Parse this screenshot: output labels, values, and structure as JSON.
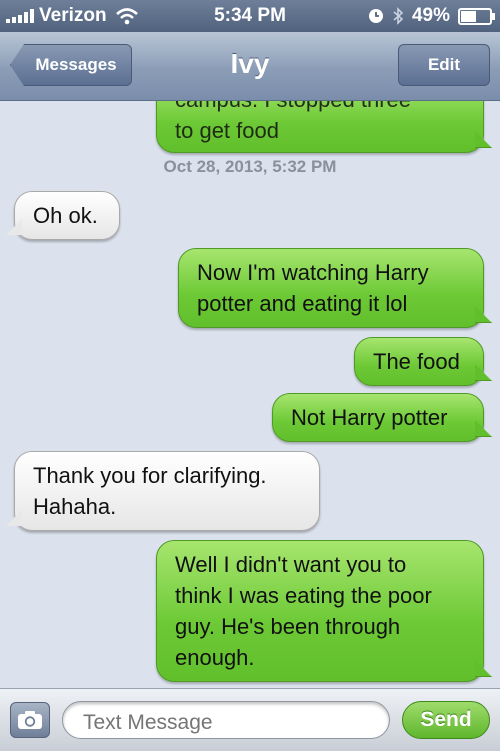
{
  "status_bar": {
    "carrier": "Verizon",
    "time": "5:34 PM",
    "battery": "49%",
    "battery_level": 0.49,
    "icons": [
      "signal-bars-icon",
      "wifi-icon",
      "alarm-clock-icon",
      "bluetooth-icon",
      "battery-icon"
    ]
  },
  "nav": {
    "back_label": "Messages",
    "title": "Ivy",
    "edit_label": "Edit"
  },
  "conversation": {
    "partial_message": {
      "from": "me",
      "line_cut": "campus. I stopped three",
      "line_visible": "to get food"
    },
    "timestamp": "Oct 28, 2013, 5:32 PM",
    "messages": [
      {
        "from": "them",
        "lines": [
          "Oh ok."
        ]
      },
      {
        "from": "me",
        "lines": [
          "Now I'm watching Harry",
          "potter and eating it lol"
        ]
      },
      {
        "from": "me",
        "lines": [
          "The food"
        ]
      },
      {
        "from": "me",
        "lines": [
          "Not Harry potter"
        ]
      },
      {
        "from": "them",
        "lines": [
          "Thank you for clarifying.",
          "Hahaha."
        ]
      },
      {
        "from": "me",
        "lines": [
          "Well I didn't want you to",
          "think I was eating the poor",
          "guy. He's been through",
          "enough."
        ]
      }
    ]
  },
  "composer": {
    "camera_icon": "camera-icon",
    "placeholder": "Text Message",
    "send_label": "Send"
  },
  "colors": {
    "sent_bubble": "#6cc935",
    "received_bubble": "#ffffff",
    "background": "#dbe2ed",
    "nav_bar": "#8b9db6"
  }
}
